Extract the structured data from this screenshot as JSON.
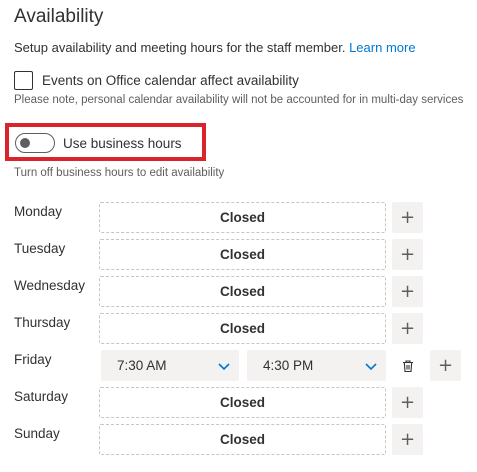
{
  "section": {
    "title": "Availability",
    "description": "Setup availability and meeting hours for the staff member.",
    "learn_more": "Learn more"
  },
  "office_calendar": {
    "label": "Events on Office calendar affect availability",
    "checked": false,
    "note": "Please note, personal calendar availability will not be accounted for in multi-day services"
  },
  "business_hours": {
    "label": "Use business hours",
    "enabled": false,
    "hint": "Turn off business hours to edit availability",
    "highlight_color": "#d9232d"
  },
  "days": [
    {
      "name": "Monday",
      "status": "Closed"
    },
    {
      "name": "Tuesday",
      "status": "Closed"
    },
    {
      "name": "Wednesday",
      "status": "Closed"
    },
    {
      "name": "Thursday",
      "status": "Closed"
    },
    {
      "name": "Friday",
      "start": "7:30 AM",
      "end": "4:30 PM"
    },
    {
      "name": "Saturday",
      "status": "Closed"
    },
    {
      "name": "Sunday",
      "status": "Closed"
    }
  ],
  "icons": {
    "add": "+",
    "delete": "trash-icon",
    "dropdown": "chevron-down-icon"
  },
  "colors": {
    "accent": "#0078d4",
    "text": "#323130",
    "muted": "#605e5c"
  }
}
